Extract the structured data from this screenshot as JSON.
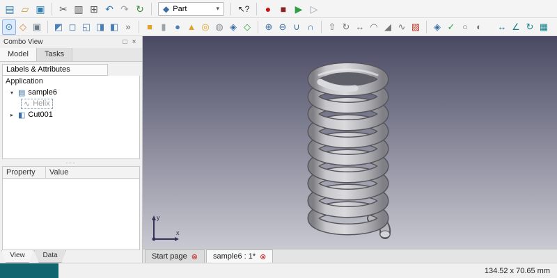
{
  "toolbars": {
    "file_group": [
      {
        "name": "new-document-icon",
        "glyph": "▤",
        "color": "#2e7db3"
      },
      {
        "name": "open-document-icon",
        "glyph": "▱",
        "color": "#d79b3c"
      },
      {
        "name": "save-icon",
        "glyph": "▣",
        "color": "#2e7db3"
      }
    ],
    "edit_group": [
      {
        "name": "cut-icon",
        "glyph": "✂",
        "color": "#555555"
      },
      {
        "name": "copy-icon",
        "glyph": "▥",
        "color": "#555555"
      },
      {
        "name": "paste-icon",
        "glyph": "⊞",
        "color": "#555555"
      },
      {
        "name": "undo-icon",
        "glyph": "↶",
        "color": "#2e7db3"
      },
      {
        "name": "redo-icon",
        "glyph": "↷",
        "color": "#9aa0a6"
      },
      {
        "name": "refresh-icon",
        "glyph": "↻",
        "color": "#3c8d3c"
      }
    ],
    "workbench": {
      "icon": "◆",
      "value": "Part",
      "caret": "▾"
    },
    "whatsthis_glyph": "↖?",
    "macro_group": [
      {
        "name": "macro-record-icon",
        "glyph": "●",
        "color": "#cc1111"
      },
      {
        "name": "macro-stop-icon",
        "glyph": "■",
        "color": "#8b2222"
      },
      {
        "name": "macro-execute-icon",
        "glyph": "▶",
        "color": "#2f9e44"
      },
      {
        "name": "macro-debug-icon",
        "glyph": "▷",
        "color": "#9aa0a6"
      }
    ],
    "nav_group": [
      {
        "name": "fit-all-icon",
        "glyph": "⊙",
        "color": "#2e7db3",
        "active": true
      },
      {
        "name": "view-axonometric-icon",
        "glyph": "◇",
        "color": "#d9822b"
      },
      {
        "name": "draw-style-icon",
        "glyph": "▣",
        "color": "#6b7a86"
      }
    ],
    "stdviews_group": [
      {
        "name": "view-isometric-icon",
        "glyph": "◩",
        "color": "#4a7fb5"
      },
      {
        "name": "view-front-icon",
        "glyph": "◻",
        "color": "#4a7fb5"
      },
      {
        "name": "view-top-icon",
        "glyph": "◱",
        "color": "#4a7fb5"
      },
      {
        "name": "view-right-icon",
        "glyph": "◨",
        "color": "#4a7fb5"
      },
      {
        "name": "view-rear-icon",
        "glyph": "◧",
        "color": "#4a7fb5"
      },
      {
        "name": "toolbar-overflow-icon",
        "glyph": "»",
        "color": "#666666"
      }
    ],
    "primitives_group": [
      {
        "name": "part-box-icon",
        "glyph": "■",
        "color": "#e0a526"
      },
      {
        "name": "part-cylinder-icon",
        "glyph": "▮",
        "color": "#9aa3ab"
      },
      {
        "name": "part-sphere-icon",
        "glyph": "●",
        "color": "#4a7fb5"
      },
      {
        "name": "part-cone-icon",
        "glyph": "▲",
        "color": "#e0a526"
      },
      {
        "name": "part-torus-icon",
        "glyph": "◎",
        "color": "#e0a526"
      },
      {
        "name": "part-tube-icon",
        "glyph": "◍",
        "color": "#8a8f94"
      },
      {
        "name": "part-primitives-icon",
        "glyph": "◈",
        "color": "#3a6ea5"
      },
      {
        "name": "part-shapebuilder-icon",
        "glyph": "◇",
        "color": "#2f9e44"
      }
    ],
    "boolean_group": [
      {
        "name": "part-boolean-icon",
        "glyph": "⊕",
        "color": "#3a6ea5"
      },
      {
        "name": "part-cut-icon",
        "glyph": "⊖",
        "color": "#3a6ea5"
      },
      {
        "name": "part-union-icon",
        "glyph": "∪",
        "color": "#3a6ea5"
      },
      {
        "name": "part-common-icon",
        "glyph": "∩",
        "color": "#3a6ea5"
      }
    ],
    "modify_group": [
      {
        "name": "part-extrude-icon",
        "glyph": "⇧",
        "color": "#777777"
      },
      {
        "name": "part-revolve-icon",
        "glyph": "↻",
        "color": "#777777"
      },
      {
        "name": "part-mirror-icon",
        "glyph": "↔",
        "color": "#777777"
      },
      {
        "name": "part-fillet-icon",
        "glyph": "◠",
        "color": "#777777"
      },
      {
        "name": "part-chamfer-icon",
        "glyph": "◢",
        "color": "#777777"
      },
      {
        "name": "part-sweep-icon",
        "glyph": "∿",
        "color": "#777777"
      },
      {
        "name": "part-section-icon",
        "glyph": "▨",
        "color": "#c0392b"
      }
    ],
    "compound_group": [
      {
        "name": "part-compound-icon",
        "glyph": "◈",
        "color": "#3a6ea5"
      },
      {
        "name": "check-geometry-icon",
        "glyph": "✓",
        "color": "#2f9e44"
      },
      {
        "name": "part-offset-icon",
        "glyph": "○",
        "color": "#777777"
      },
      {
        "name": "part-thickness-icon",
        "glyph": "◐",
        "color": "#777777"
      }
    ],
    "measure_group": [
      {
        "name": "measure-linear-icon",
        "glyph": "↔",
        "color": "#17808a"
      },
      {
        "name": "measure-angular-icon",
        "glyph": "∠",
        "color": "#17808a"
      },
      {
        "name": "measure-refresh-icon",
        "glyph": "↻",
        "color": "#17808a"
      },
      {
        "name": "measure-toggle-icon",
        "glyph": "▦",
        "color": "#17808a"
      }
    ]
  },
  "sidebar": {
    "title": "Combo View",
    "header_icons": {
      "float": "□",
      "close": "×"
    },
    "tabs": [
      {
        "name": "tab-model",
        "label": "Model",
        "active": true
      },
      {
        "name": "tab-tasks",
        "label": "Tasks"
      }
    ],
    "labels_header": "Labels & Attributes",
    "application_label": "Application",
    "tree": {
      "nodes": [
        {
          "label": "sample6",
          "expander": "▾",
          "icon": "▤"
        },
        {
          "label": "Helix",
          "icon": "∿"
        },
        {
          "label": "Cut001",
          "expander": "▸",
          "icon": "◧"
        }
      ]
    },
    "splitter": "···",
    "property_table": {
      "columns": [
        "Property",
        "Value"
      ]
    },
    "bottom_tabs": [
      {
        "name": "tab-view",
        "label": "View",
        "active": true
      },
      {
        "name": "tab-data",
        "label": "Data"
      }
    ]
  },
  "viewport": {
    "gradient_top": "#494963",
    "gradient_bottom": "#c9c9d2",
    "axis": {
      "x": "x",
      "y": "y"
    }
  },
  "mdi": {
    "tabs": [
      {
        "name": "tab-start-page",
        "label": "Start page",
        "close": "⊗"
      },
      {
        "name": "tab-sample6-document",
        "label": "sample6 : 1*",
        "close": "⊗",
        "active": true
      }
    ]
  },
  "statusbar": {
    "dimensions": "134.52 x 70.65 mm"
  }
}
